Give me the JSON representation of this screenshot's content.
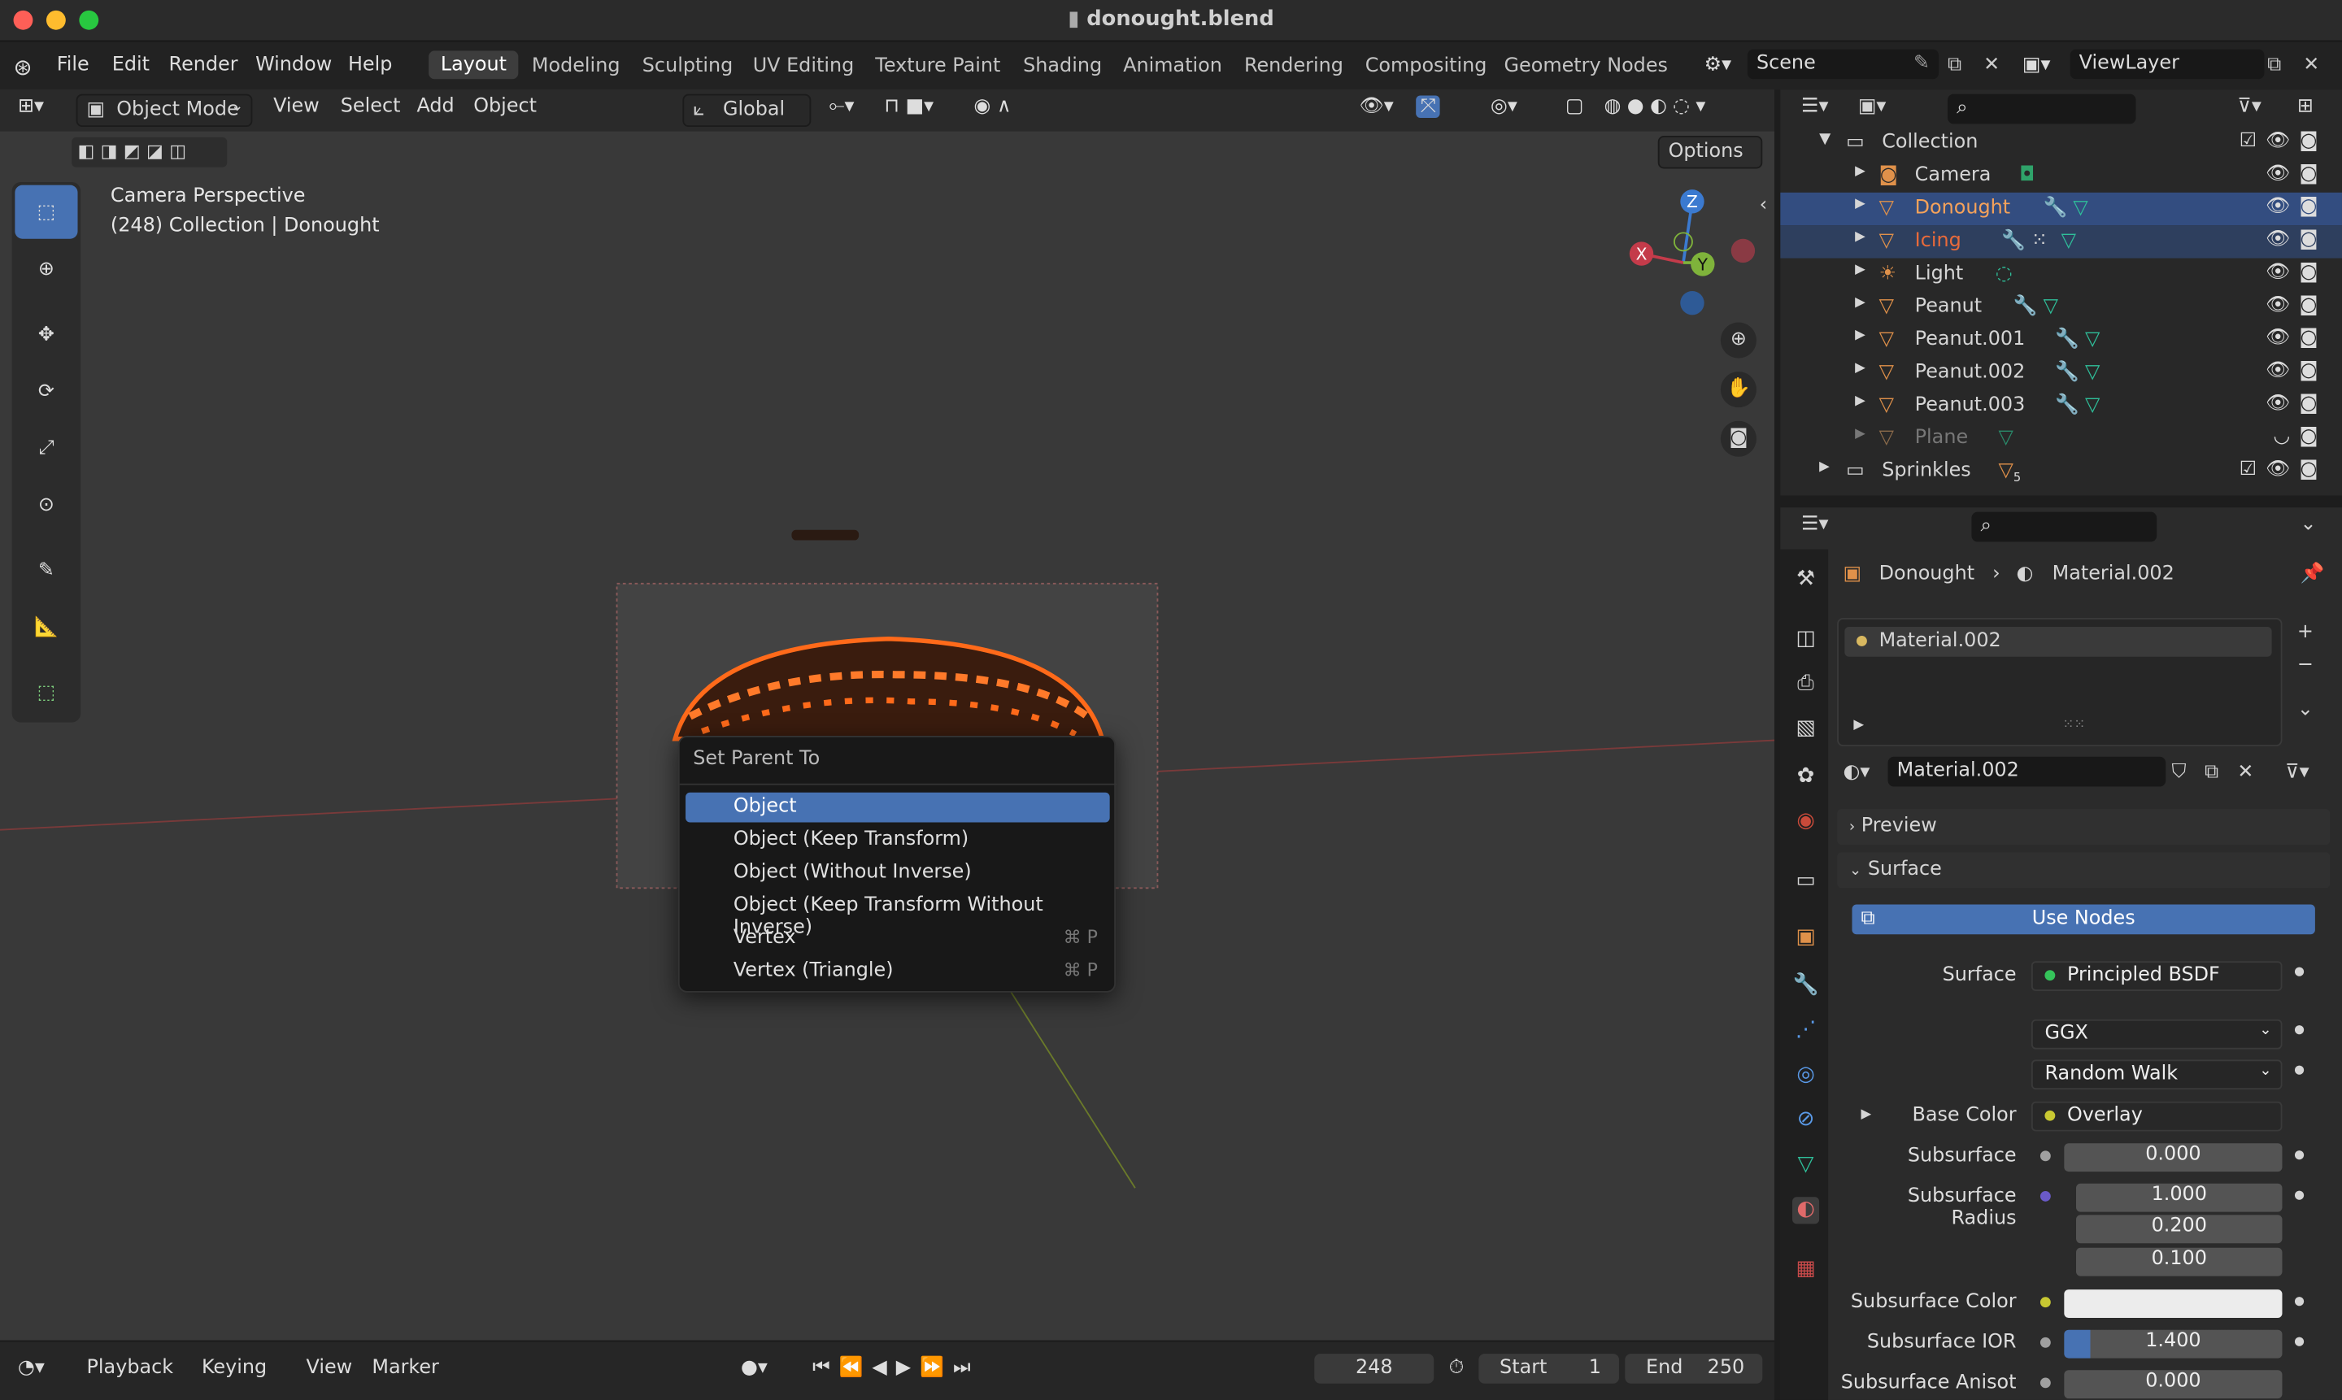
{
  "window": {
    "title": "donought.blend"
  },
  "menu": {
    "items": [
      "File",
      "Edit",
      "Render",
      "Window",
      "Help"
    ]
  },
  "workspaces": [
    "Layout",
    "Modeling",
    "Sculpting",
    "UV Editing",
    "Texture Paint",
    "Shading",
    "Animation",
    "Rendering",
    "Compositing",
    "Geometry Nodes"
  ],
  "scene": {
    "name": "Scene",
    "view_layer": "ViewLayer"
  },
  "viewport": {
    "mode": "Object Mode",
    "menus": [
      "View",
      "Select",
      "Add",
      "Object"
    ],
    "orientation": "Global",
    "options": "Options",
    "overlay_title": "Camera Perspective",
    "overlay_sub": "(248) Collection | Donought"
  },
  "gizmo": {
    "x": "X",
    "y": "Y",
    "z": "Z"
  },
  "popup": {
    "title": "Set Parent To",
    "items": [
      {
        "label": "Object",
        "shortcut": ""
      },
      {
        "label": "Object (Keep Transform)",
        "shortcut": ""
      },
      {
        "label": "Object (Without Inverse)",
        "shortcut": ""
      },
      {
        "label": "Object (Keep Transform Without Inverse)",
        "shortcut": ""
      },
      {
        "label": "Vertex",
        "shortcut": "⌘ P"
      },
      {
        "label": "Vertex (Triangle)",
        "shortcut": "⌘ P"
      }
    ]
  },
  "outliner": {
    "collection": "Collection",
    "items": [
      "Camera",
      "Donought",
      "Icing",
      "Light",
      "Peanut",
      "Peanut.001",
      "Peanut.002",
      "Peanut.003",
      "Plane"
    ],
    "sprinkles": "Sprinkles",
    "sprinkles_count": "5"
  },
  "properties": {
    "object": "Donought",
    "material": "Material.002",
    "slot": "Material.002",
    "preview": "Preview",
    "surface_panel": "Surface",
    "use_nodes": "Use Nodes",
    "rows": [
      {
        "label": "Surface",
        "value": "Principled BSDF"
      },
      {
        "label": "",
        "value": "GGX"
      },
      {
        "label": "",
        "value": "Random Walk"
      },
      {
        "label": "Base Color",
        "value": "Overlay"
      },
      {
        "label": "Subsurface",
        "value": "0.000"
      },
      {
        "label": "Subsurface Radius",
        "value": "1.000"
      },
      {
        "label": "",
        "value": "0.200"
      },
      {
        "label": "",
        "value": "0.100"
      },
      {
        "label": "Subsurface Color",
        "value": ""
      },
      {
        "label": "Subsurface IOR",
        "value": "1.400"
      },
      {
        "label": "Subsurface Anisot",
        "value": "0.000"
      }
    ]
  },
  "timeline": {
    "items": [
      "Playback",
      "Keying",
      "View",
      "Marker"
    ],
    "frame": "248",
    "start_label": "Start",
    "start": "1",
    "end_label": "End",
    "end": "250"
  },
  "colors": {
    "accent": "#4772b3",
    "selection_text": "#f5a25a",
    "icing": "#e86a3a"
  }
}
